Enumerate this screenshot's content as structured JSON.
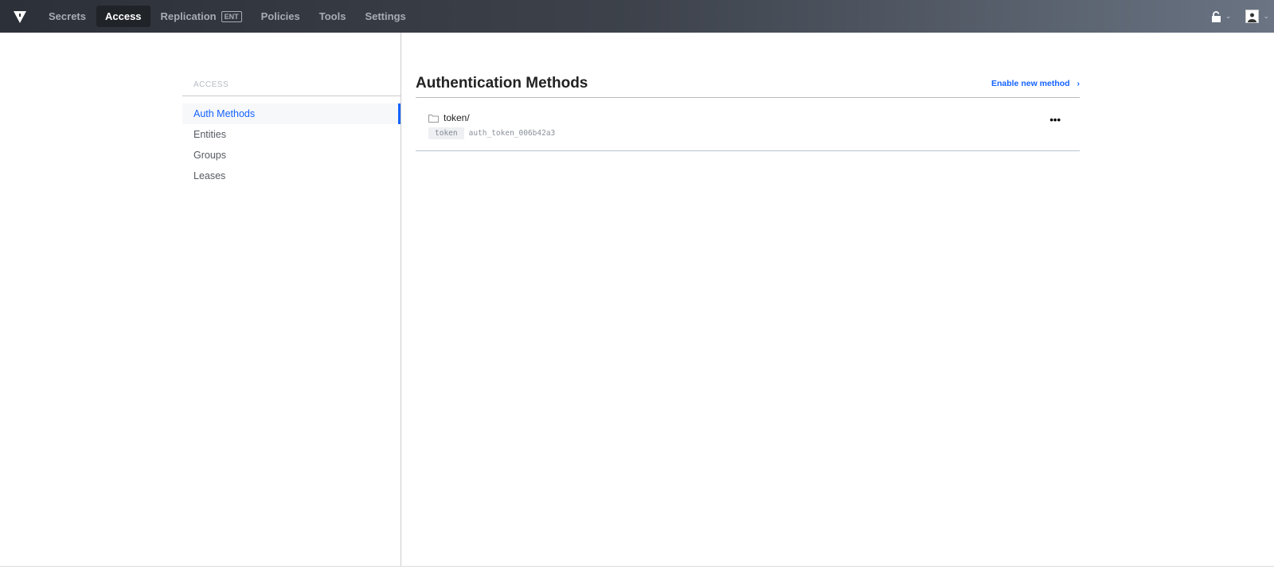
{
  "nav": {
    "items": [
      {
        "label": "Secrets"
      },
      {
        "label": "Access",
        "active": true
      },
      {
        "label": "Replication",
        "badge": "ENT"
      },
      {
        "label": "Policies"
      },
      {
        "label": "Tools"
      },
      {
        "label": "Settings"
      }
    ]
  },
  "sidebar": {
    "heading": "ACCESS",
    "items": [
      {
        "label": "Auth Methods",
        "active": true
      },
      {
        "label": "Entities"
      },
      {
        "label": "Groups"
      },
      {
        "label": "Leases"
      }
    ]
  },
  "main": {
    "title": "Authentication Methods",
    "enable_label": "Enable new method",
    "methods": [
      {
        "path": "token/",
        "type": "token",
        "accessor": "auth_token_006b42a3"
      }
    ]
  },
  "colors": {
    "accent": "#1563ff"
  }
}
